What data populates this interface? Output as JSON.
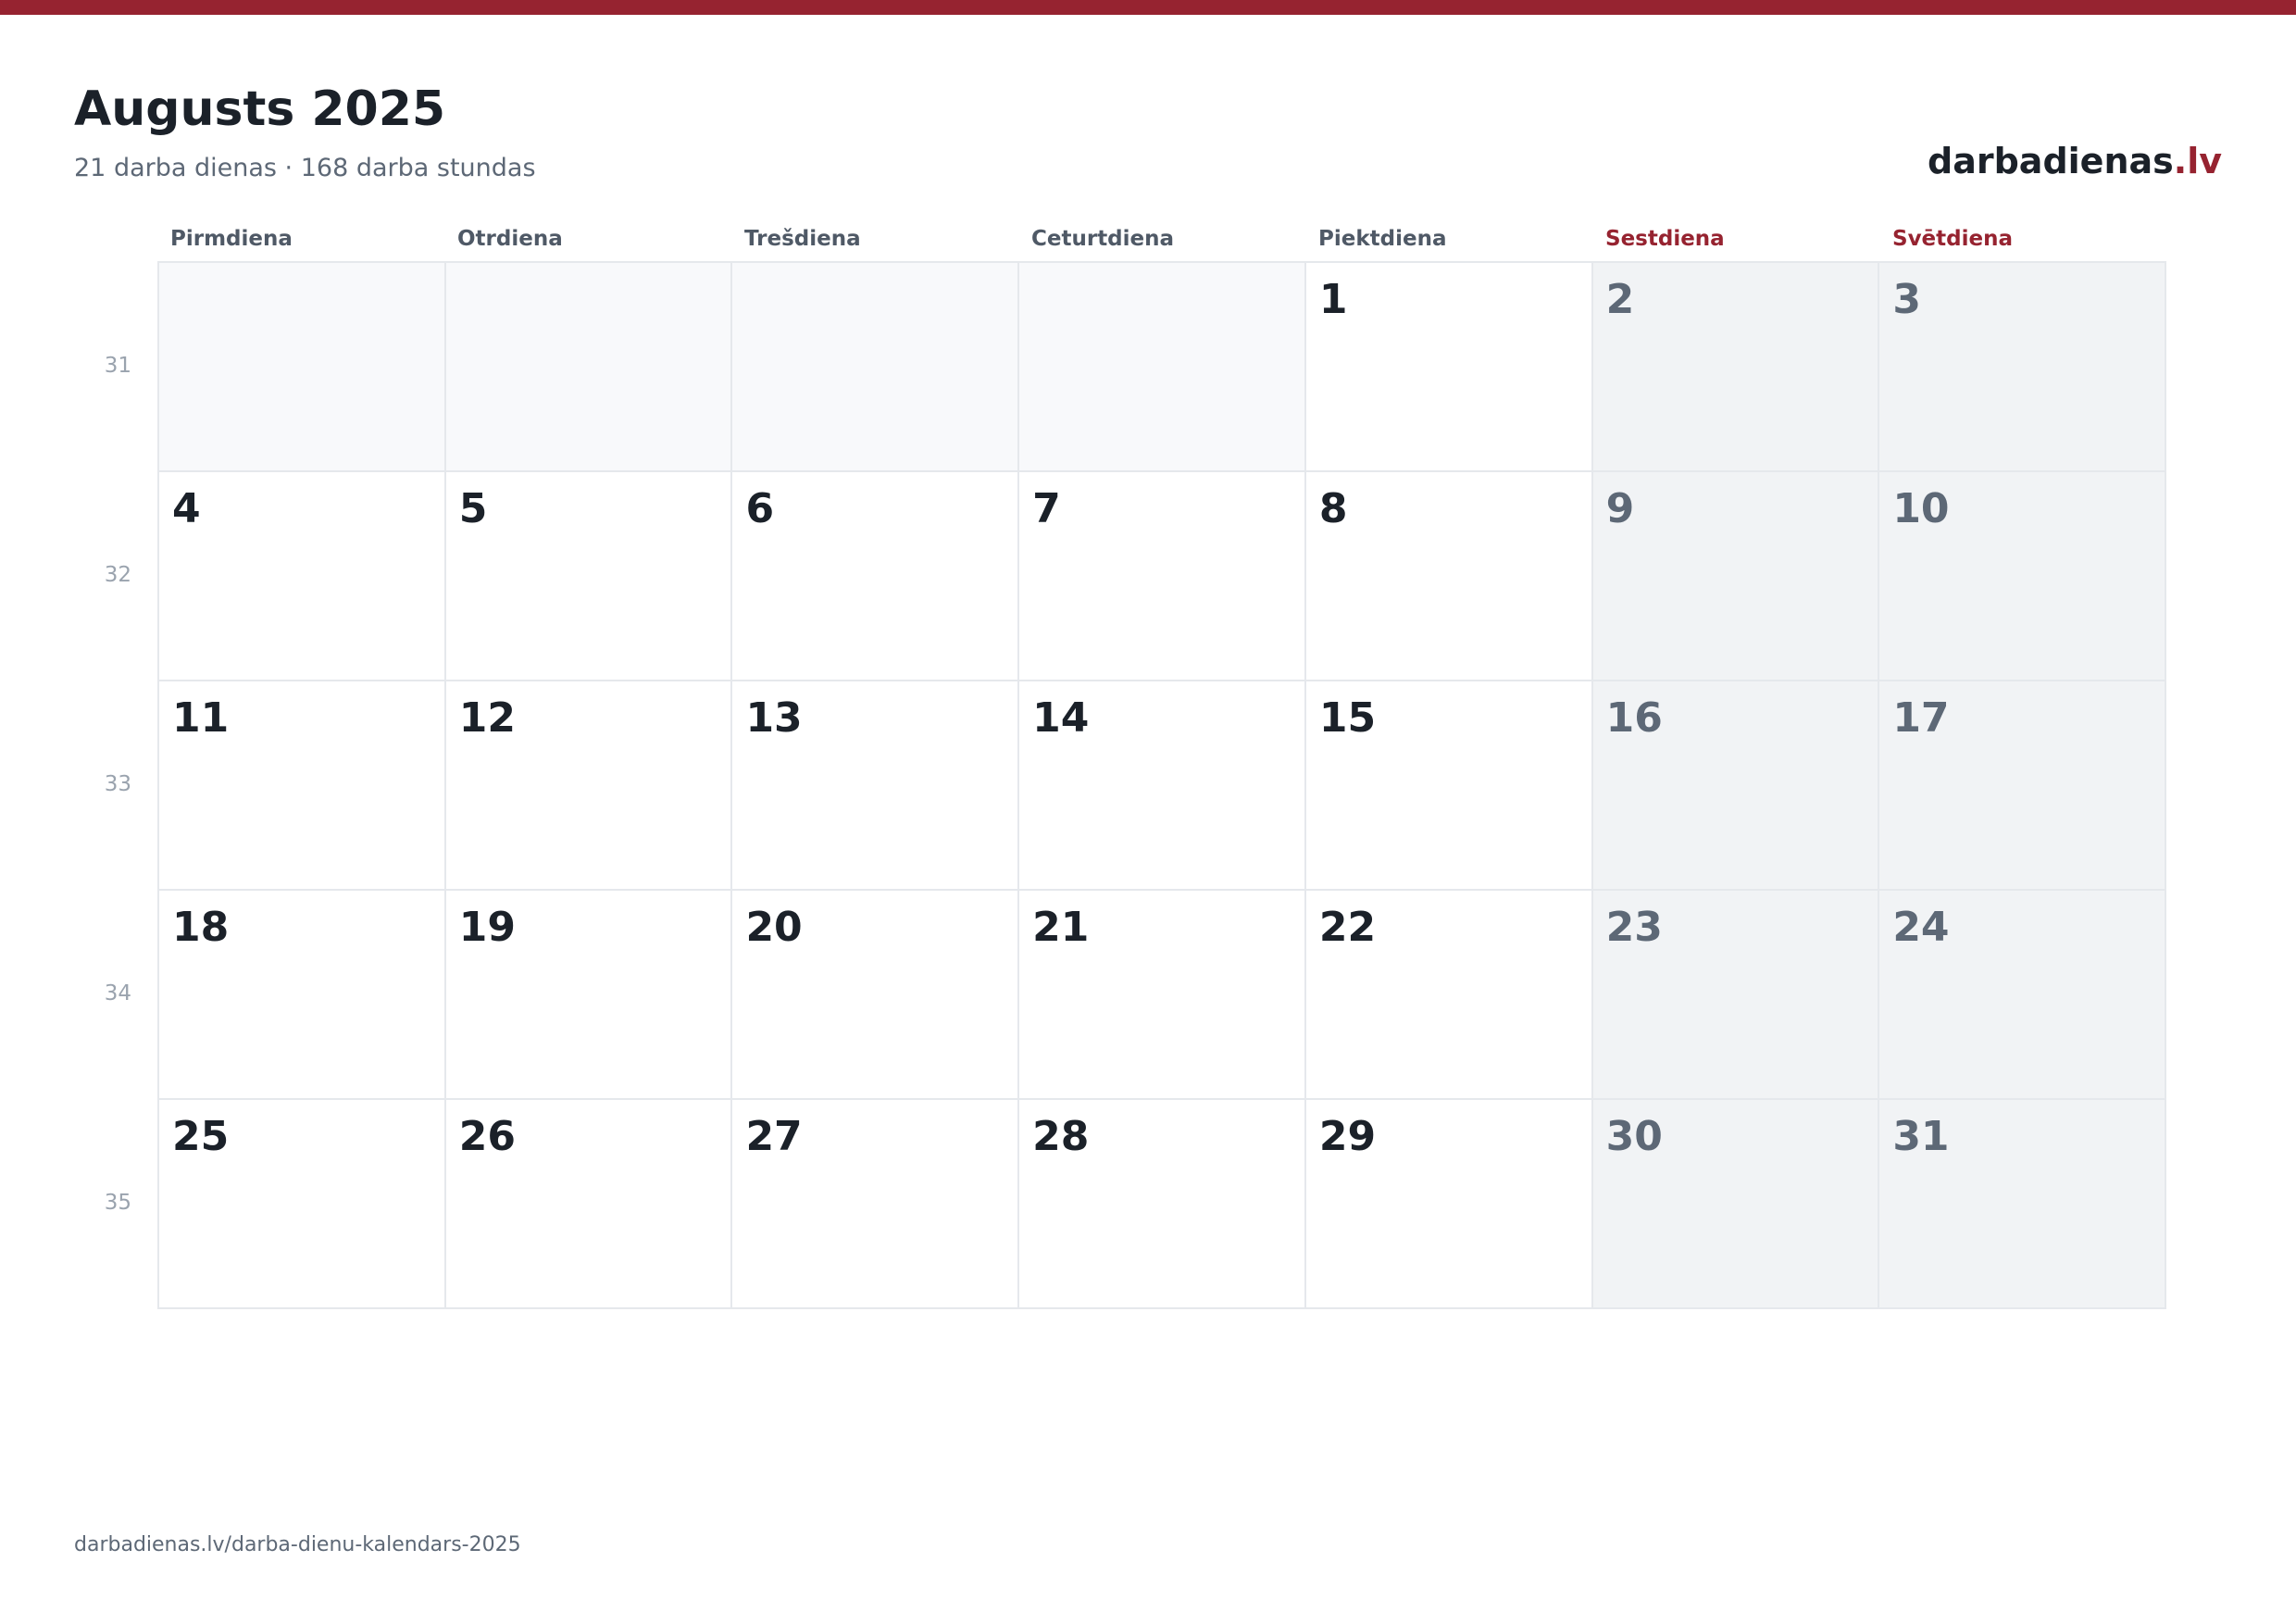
{
  "header": {
    "title": "Augusts 2025",
    "subtitle": "21 darba dienas · 168 darba stundas",
    "brand_name": "darbadienas",
    "brand_tld": ".lv"
  },
  "colors": {
    "accent": "#962330",
    "text": "#1b2129",
    "muted": "#5d6876",
    "weekend_bg": "#f1f3f5",
    "empty_bg": "#f8f9fb",
    "border": "#e5e8ec"
  },
  "weekdays": [
    {
      "label": "Pirmdiena",
      "weekend": false
    },
    {
      "label": "Otrdiena",
      "weekend": false
    },
    {
      "label": "Trešdiena",
      "weekend": false
    },
    {
      "label": "Ceturtdiena",
      "weekend": false
    },
    {
      "label": "Piektdiena",
      "weekend": false
    },
    {
      "label": "Sestdiena",
      "weekend": true
    },
    {
      "label": "Svētdiena",
      "weekend": true
    }
  ],
  "weeks": [
    {
      "number": "31",
      "days": [
        "",
        "",
        "",
        "",
        "1",
        "2",
        "3"
      ]
    },
    {
      "number": "32",
      "days": [
        "4",
        "5",
        "6",
        "7",
        "8",
        "9",
        "10"
      ]
    },
    {
      "number": "33",
      "days": [
        "11",
        "12",
        "13",
        "14",
        "15",
        "16",
        "17"
      ]
    },
    {
      "number": "34",
      "days": [
        "18",
        "19",
        "20",
        "21",
        "22",
        "23",
        "24"
      ]
    },
    {
      "number": "35",
      "days": [
        "25",
        "26",
        "27",
        "28",
        "29",
        "30",
        "31"
      ]
    }
  ],
  "footer": {
    "url_text": "darbadienas.lv/darba-dienu-kalendars-2025"
  }
}
